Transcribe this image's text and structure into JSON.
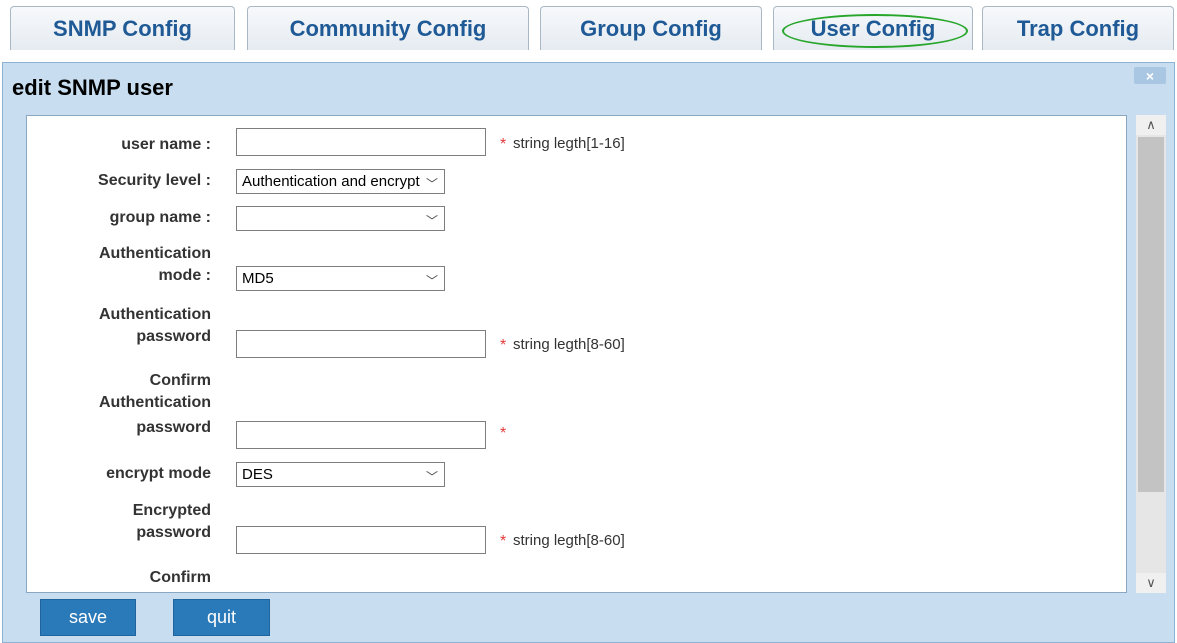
{
  "tabs": [
    {
      "label": "SNMP Config"
    },
    {
      "label": "Community Config"
    },
    {
      "label": "Group Config"
    },
    {
      "label": "User Config"
    },
    {
      "label": "Trap Config"
    }
  ],
  "dialog": {
    "title": "edit SNMP user",
    "close_icon": "×"
  },
  "form": {
    "user_name": {
      "label": "user name :",
      "value": "",
      "required": "*",
      "hint": "string legth[1-16]"
    },
    "security_level": {
      "label": "Security level :",
      "value": "Authentication and encryption"
    },
    "group_name": {
      "label": "group name :",
      "value": ""
    },
    "auth_mode": {
      "label_line1": "Authentication",
      "label_line2": "mode :",
      "value": "MD5"
    },
    "auth_password": {
      "label_line1": "Authentication",
      "label_line2": "password",
      "value": "",
      "required": "*",
      "hint": "string legth[8-60]"
    },
    "confirm_auth_password": {
      "label_line1": "Confirm",
      "label_line2": "Authentication",
      "label_line3": "password",
      "value": "",
      "required": "*"
    },
    "encrypt_mode": {
      "label": "encrypt mode",
      "value": "DES"
    },
    "encrypted_password": {
      "label_line1": "Encrypted",
      "label_line2": "password",
      "value": "",
      "required": "*",
      "hint": "string legth[8-60]"
    },
    "confirm_encrypted_password": {
      "label_line1": "Confirm"
    }
  },
  "buttons": {
    "save": "save",
    "quit": "quit"
  },
  "icons": {
    "chevron": "﹀",
    "scroll_up": "∧",
    "scroll_down": "∨"
  },
  "colors": {
    "tab_text": "#1f5a96",
    "highlight": "#27a62b",
    "dialog_bg": "#c8def0",
    "button_bg": "#2a79b8",
    "required": "#e53b3b"
  }
}
